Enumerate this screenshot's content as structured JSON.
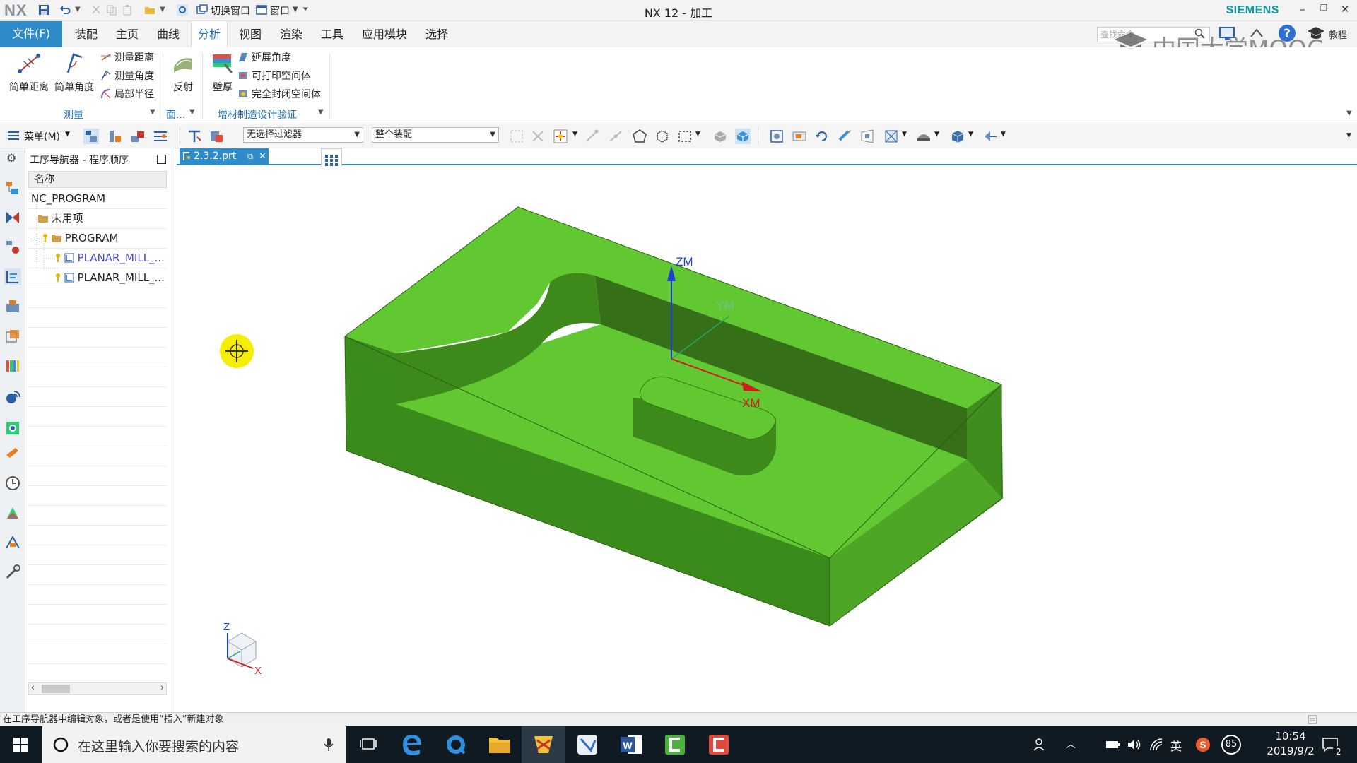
{
  "titlebar": {
    "logo": "NX",
    "switch_window": "切换窗口",
    "window_menu": "窗口",
    "title": "NX 12 - 加工",
    "brand": "SIEMENS"
  },
  "menu": {
    "file": "文件(F)",
    "tabs": [
      "装配",
      "主页",
      "曲线",
      "分析",
      "视图",
      "渲染",
      "工具",
      "应用模块",
      "选择"
    ],
    "active_tab": "分析",
    "search_placeholder": "查找命令",
    "tutorial": "教程",
    "watermark": "中国大学MOOC"
  },
  "ribbon": {
    "simple_distance": "简单距离",
    "simple_angle": "简单角度",
    "measure_distance": "测量距离",
    "measure_angle": "测量角度",
    "local_radius": "局部半径",
    "group_measure": "测量",
    "reflection": "反射",
    "group_face": "面...",
    "thickness": "壁厚",
    "draft_angle": "延展角度",
    "printable_volume": "可打印空间体",
    "enclosed_volume": "完全封闭空间体",
    "group_additive": "增材制造设计验证"
  },
  "cmdbar": {
    "menu_label": "菜单(M)",
    "filter": "无选择过滤器",
    "scope": "整个装配"
  },
  "navigator": {
    "title": "工序导航器 - 程序顺序",
    "column": "名称",
    "rows": [
      "NC_PROGRAM",
      "未用项",
      "PROGRAM",
      "PLANAR_MILL_...",
      "PLANAR_MILL_..."
    ]
  },
  "document": {
    "tab": "2.3.2.prt"
  },
  "viewport": {
    "axis_zm": "ZM",
    "axis_ym": "YM",
    "axis_xm": "XM",
    "triad_z": "Z",
    "triad_x": "X",
    "part_colors": {
      "top": "#62c832",
      "front": "#3b8a1c",
      "side": "#4ea626",
      "wall": "#356f17"
    }
  },
  "status": {
    "message": "在工序导航器中编辑对象，或者是使用“插入”新建对象"
  },
  "taskbar": {
    "search_text": "在这里输入你要搜索的内容",
    "ime": "英",
    "badge": "85",
    "time": "10:54",
    "date": "2019/9/2",
    "notifications": "2"
  }
}
